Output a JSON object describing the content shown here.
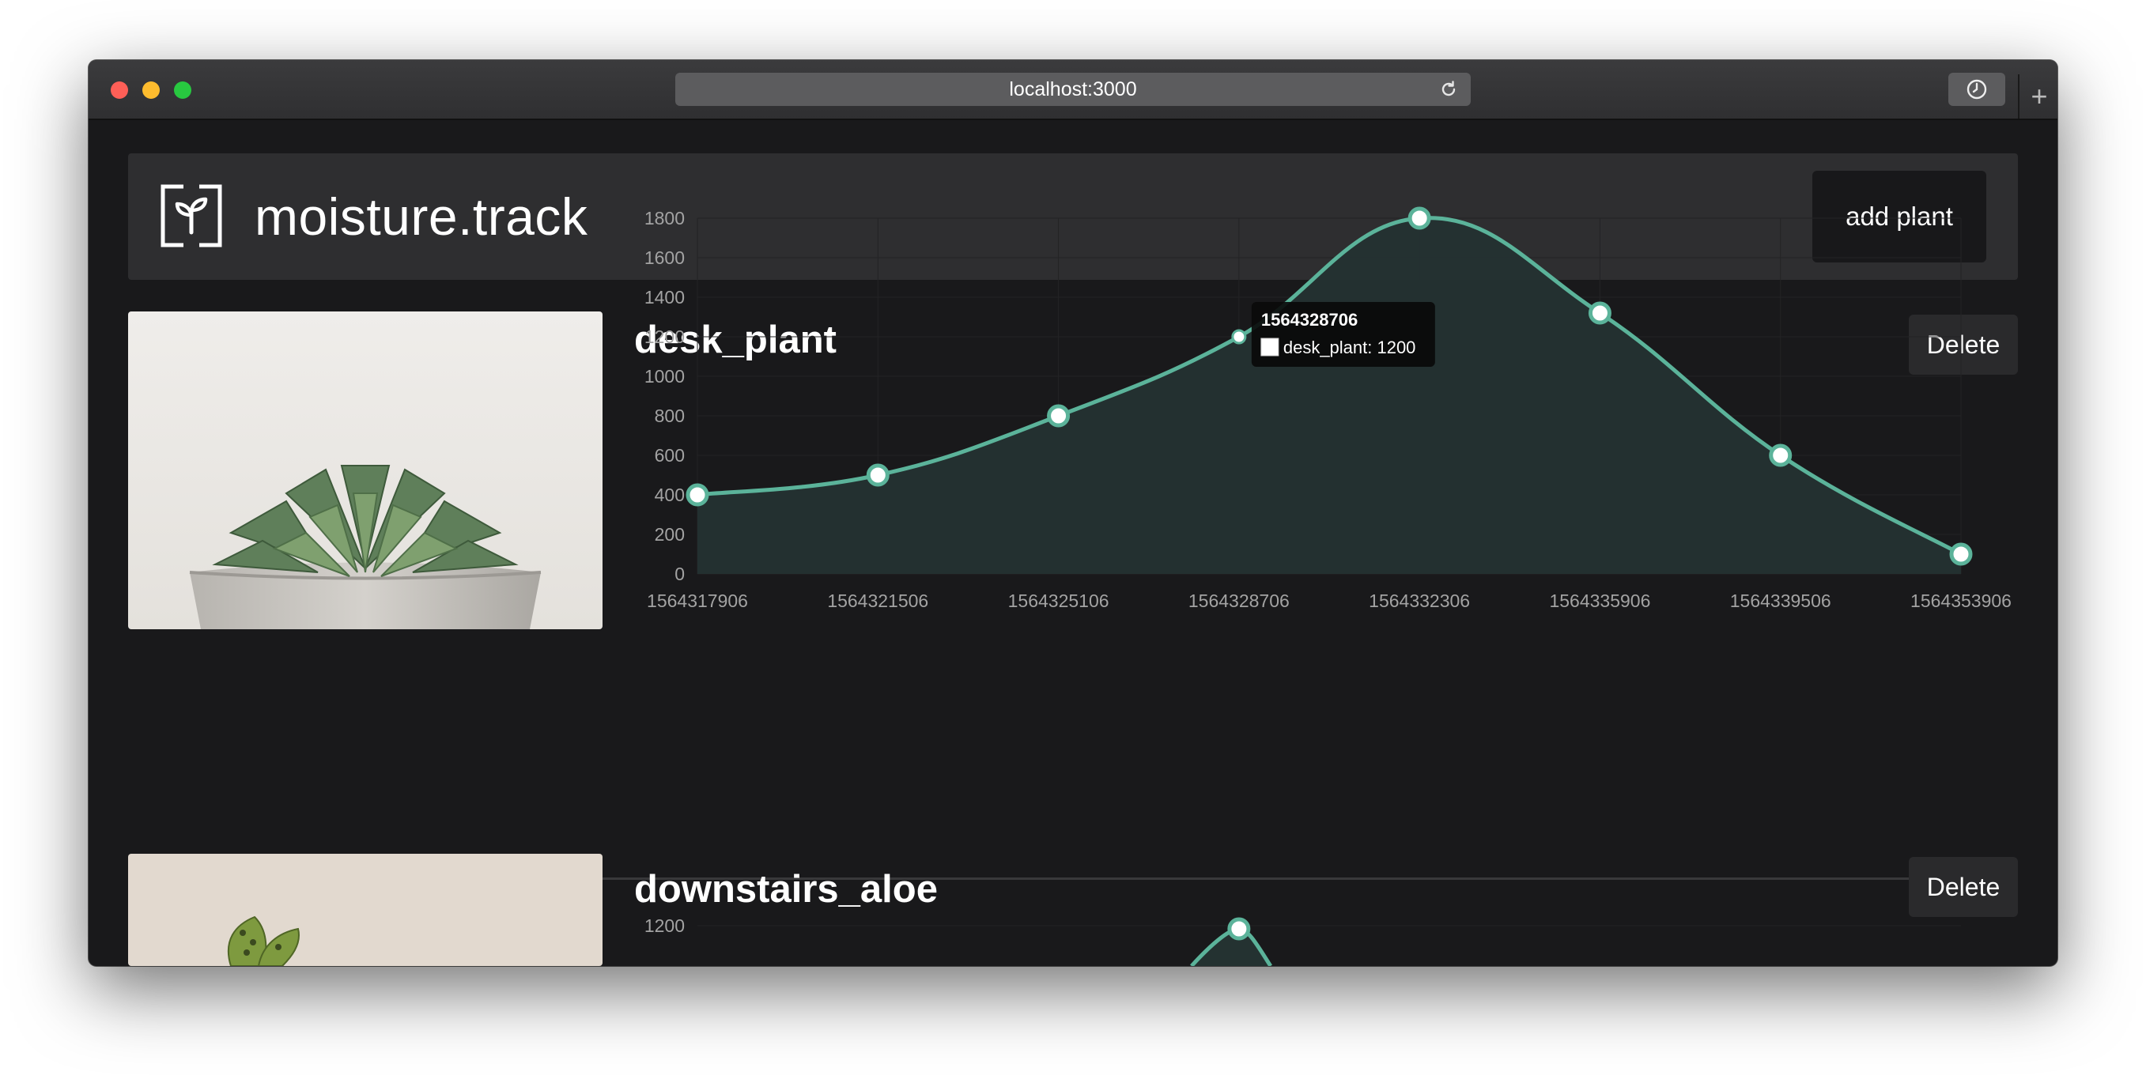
{
  "browser": {
    "url": "localhost:3000"
  },
  "app": {
    "brand": "moisture.track",
    "add_button": "add plant"
  },
  "plants": [
    {
      "name": "desk_plant",
      "delete_label": "Delete",
      "image": "succulent-in-concrete-pot"
    },
    {
      "name": "downstairs_aloe",
      "delete_label": "Delete",
      "image": "aloe-plant"
    }
  ],
  "colors": {
    "accent": "#5bb39a",
    "fill": "#243231",
    "background": "#19191b",
    "header": "#2e2e30"
  },
  "chart_data": [
    {
      "type": "area",
      "series": [
        {
          "name": "desk_plant",
          "values": [
            400,
            500,
            800,
            1200,
            1800,
            1320,
            600,
            100
          ]
        }
      ],
      "x": [
        "1564317906",
        "1564321506",
        "1564325106",
        "1564328706",
        "1564332306",
        "1564335906",
        "1564339506",
        "1564353906"
      ],
      "yticks": [
        "0",
        "200",
        "400",
        "600",
        "800",
        "1000",
        "1200",
        "1400",
        "1600",
        "1800"
      ],
      "ylim": [
        0,
        1800
      ],
      "tooltip": {
        "title": "1564328706",
        "label": "desk_plant: 1200"
      }
    },
    {
      "type": "area",
      "yticks": [
        "1200"
      ]
    }
  ]
}
